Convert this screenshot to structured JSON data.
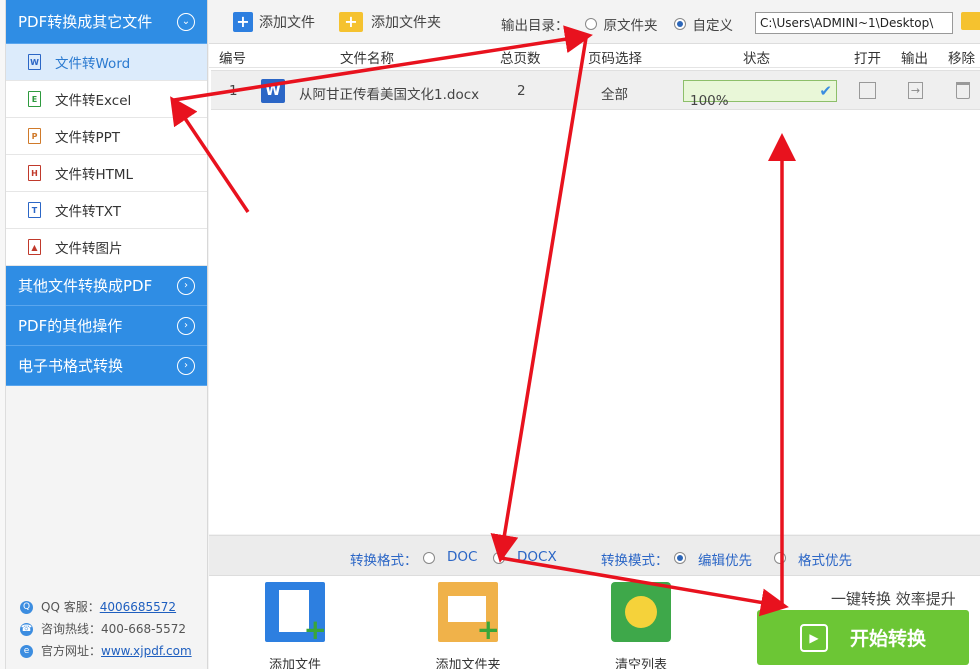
{
  "sidebar": {
    "category_main": "PDF转换成其它文件",
    "items": [
      {
        "label": "文件转Word",
        "icon": "word-file-icon"
      },
      {
        "label": "文件转Excel",
        "icon": "excel-file-icon"
      },
      {
        "label": "文件转PPT",
        "icon": "ppt-file-icon"
      },
      {
        "label": "文件转HTML",
        "icon": "html-file-icon"
      },
      {
        "label": "文件转TXT",
        "icon": "txt-file-icon"
      },
      {
        "label": "文件转图片",
        "icon": "image-file-icon"
      }
    ],
    "categories": [
      "其他文件转换成PDF",
      "PDF的其他操作",
      "电子书格式转换"
    ],
    "contact": {
      "qq_label": "QQ 客服：",
      "qq_value": "4006685572",
      "hotline": "咨询热线：400-668-5572",
      "site_label": "官方网址：",
      "site_value": "www.xjpdf.com"
    }
  },
  "toolbar": {
    "add_file": "添加文件",
    "add_folder": "添加文件夹",
    "output_label": "输出目录：",
    "option_original": "原文件夹",
    "option_custom": "自定义",
    "selected": "自定义",
    "path": "C:\\Users\\ADMINI~1\\Desktop\\"
  },
  "table": {
    "headers": [
      "编号",
      "文件名称",
      "总页数",
      "页码选择",
      "状态",
      "打开",
      "输出",
      "移除"
    ],
    "rows": [
      {
        "index": "1",
        "name": "从阿甘正传看美国文化1.docx",
        "pages": "2",
        "range": "全部",
        "status": "100%"
      }
    ]
  },
  "format_bar": {
    "format_label": "转换格式：",
    "opt_doc": "DOC",
    "opt_docx": "DOCX",
    "mode_label": "转换模式：",
    "opt_edit": "编辑优先",
    "opt_format": "格式优先",
    "selected_mode": "编辑优先"
  },
  "bottom": {
    "add_file": "添加文件",
    "add_folder": "添加文件夹",
    "clear_list": "清空列表",
    "slogan": "一键转换  效率提升",
    "start": "开始转换"
  },
  "colors": {
    "accent": "#2f8de4",
    "start": "#6cc635",
    "arrow": "#e8121e"
  }
}
